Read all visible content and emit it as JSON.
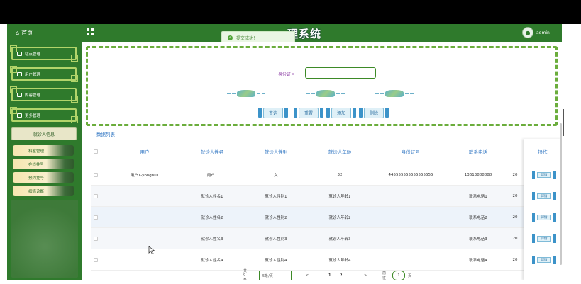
{
  "header": {
    "home_label": "首页",
    "app_title": "就诊人员管理系统",
    "title_visible": "理系统",
    "toast": "提交成功！",
    "user_name": "admin"
  },
  "sidebar": {
    "menus": [
      {
        "label": "站点管理"
      },
      {
        "label": "用户管理"
      },
      {
        "label": "内容管理"
      },
      {
        "label": "更多管理"
      }
    ],
    "submenu_active": "就诊人信息",
    "sub_items": [
      {
        "label": "科室管理"
      },
      {
        "label": "在线挂号"
      },
      {
        "label": "预约挂号"
      },
      {
        "label": "病情诊断"
      }
    ]
  },
  "search": {
    "id_label": "身份证号",
    "id_value": "",
    "buttons": {
      "query": "查询",
      "reset": "重置",
      "add": "添加",
      "delete": "删除"
    }
  },
  "list_title": "数据列表",
  "table": {
    "headers": [
      "用户",
      "就诊人姓名",
      "就诊人性别",
      "就诊人年龄",
      "身份证号",
      "联系电话",
      "操作"
    ],
    "rows": [
      {
        "user": "用户1-yonghu1",
        "name": "用户1",
        "gender": "女",
        "age": "32",
        "id_no": "445555555555555555",
        "phone": "13613888888",
        "date": "20"
      },
      {
        "user": "",
        "name": "就诊人姓名1",
        "gender": "就诊人性别1",
        "age": "就诊人年龄1",
        "id_no": "",
        "phone": "联系电话1",
        "date": "20"
      },
      {
        "user": "",
        "name": "就诊人姓名2",
        "gender": "就诊人性别2",
        "age": "就诊人年龄2",
        "id_no": "",
        "phone": "联系电话2",
        "date": "20"
      },
      {
        "user": "",
        "name": "就诊人姓名3",
        "gender": "就诊人性别3",
        "age": "就诊人年龄3",
        "id_no": "",
        "phone": "联系电话3",
        "date": "20"
      },
      {
        "user": "",
        "name": "就诊人姓名4",
        "gender": "就诊人性别4",
        "age": "就诊人年龄4",
        "id_no": "",
        "phone": "联系电话4",
        "date": "20"
      }
    ],
    "detail_label": "详情"
  },
  "pagination": {
    "total": "共 9 条",
    "page_size": "5条/页",
    "prev": "<",
    "pages": [
      "1",
      "2"
    ],
    "next": ">",
    "goto_label": "前往",
    "goto_value": "1",
    "page_unit": "页"
  },
  "colors": {
    "primary": "#2f7a2c",
    "accent": "#3579c4",
    "border": "#6bad3c"
  }
}
